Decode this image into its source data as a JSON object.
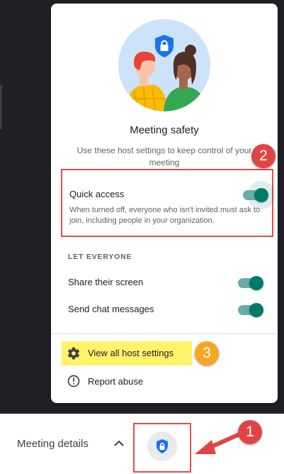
{
  "panel": {
    "title": "Meeting safety",
    "subtitle": "Use these host settings to keep control of your meeting",
    "quick_access": {
      "label": "Quick access",
      "description": "When turned off, everyone who isn't invited must ask to join, including people in your organization.",
      "enabled": true
    },
    "section_label": "LET EVERYONE",
    "toggles": [
      {
        "label": "Share their screen",
        "enabled": true
      },
      {
        "label": "Send chat messages",
        "enabled": true
      }
    ],
    "links": {
      "host_settings": "View all host settings",
      "report_abuse": "Report abuse"
    }
  },
  "bottom_bar": {
    "details_label": "Meeting details"
  },
  "annotations": {
    "badge1": "1",
    "badge2": "2",
    "badge3": "3"
  },
  "colors": {
    "toggle_on": "#00796b",
    "accent_blue": "#1a73e8",
    "annotation_red": "#e34d4d",
    "highlight_yellow": "#fff36a",
    "badge_orange": "#f6a623"
  },
  "icons": [
    "shield-lock-icon",
    "gear-icon",
    "report-icon",
    "chevron-up-icon"
  ]
}
